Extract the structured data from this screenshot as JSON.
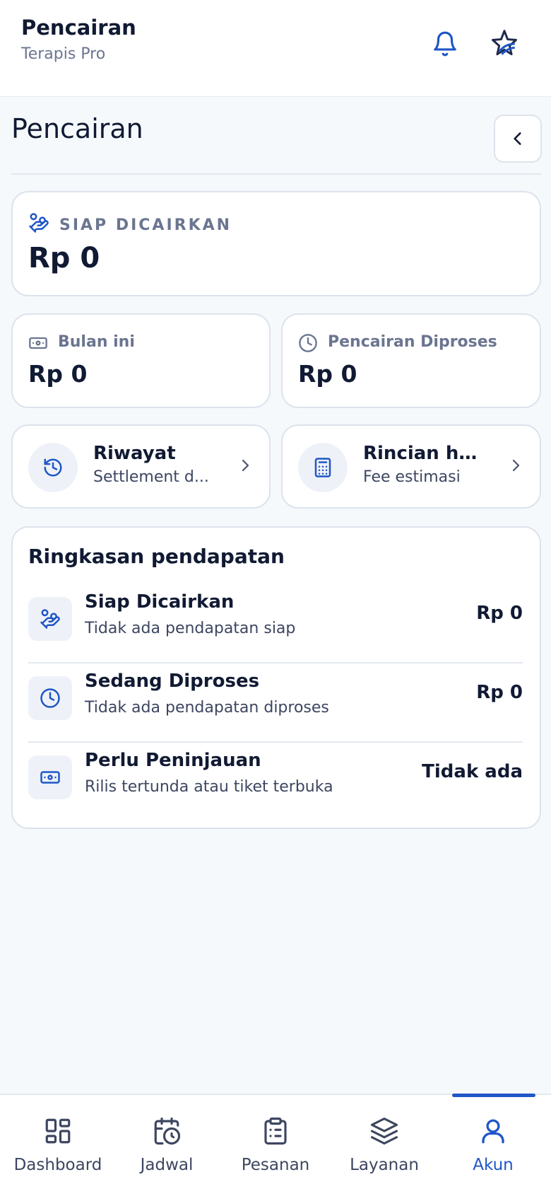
{
  "header": {
    "title": "Pencairan",
    "subtitle": "Terapis Pro"
  },
  "page": {
    "title": "Pencairan"
  },
  "ready": {
    "label": "SIAP DICAIRKAN",
    "amount": "Rp 0"
  },
  "stats": [
    {
      "label": "Bulan ini",
      "amount": "Rp 0",
      "icon": "banknote-icon"
    },
    {
      "label": "Pencairan Diproses",
      "amount": "Rp 0",
      "icon": "clock-icon"
    }
  ],
  "nav_cards": [
    {
      "title": "Riwayat",
      "subtitle": "Settlement d...",
      "icon": "history-icon"
    },
    {
      "title": "Rincian har...",
      "subtitle": "Fee estimasi",
      "icon": "calculator-icon"
    }
  ],
  "summary": {
    "title": "Ringkasan pendapatan",
    "rows": [
      {
        "name": "Siap Dicairkan",
        "desc": "Tidak ada pendapatan siap",
        "value": "Rp 0",
        "icon": "hand-coins-icon"
      },
      {
        "name": "Sedang Diproses",
        "desc": "Tidak ada pendapatan diproses",
        "value": "Rp 0",
        "icon": "clock-icon"
      },
      {
        "name": "Perlu Peninjauan",
        "desc": "Rilis tertunda atau tiket terbuka",
        "value": "Tidak ada",
        "icon": "banknote-icon"
      }
    ]
  },
  "bottom_nav": {
    "active": "Akun",
    "tabs": [
      {
        "label": "Dashboard",
        "icon": "grid-icon"
      },
      {
        "label": "Jadwal",
        "icon": "calendar-clock-icon"
      },
      {
        "label": "Pesanan",
        "icon": "clipboard-icon"
      },
      {
        "label": "Layanan",
        "icon": "layers-icon"
      },
      {
        "label": "Akun",
        "icon": "user-icon"
      }
    ]
  },
  "colors": {
    "accent": "#1f56c7",
    "text": "#111a33",
    "muted": "#6b7590",
    "background": "#f6f9fc"
  }
}
